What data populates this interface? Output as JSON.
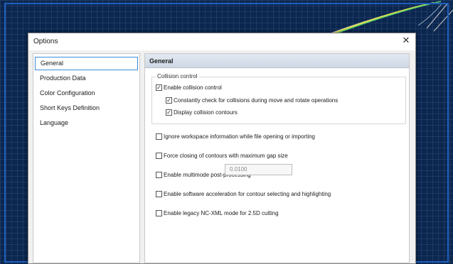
{
  "window": {
    "title": "Options",
    "close_glyph": "✕"
  },
  "nav": {
    "items": [
      {
        "label": "General",
        "selected": true
      },
      {
        "label": "Production Data",
        "selected": false
      },
      {
        "label": "Color Configuration",
        "selected": false
      },
      {
        "label": "Short Keys Definition",
        "selected": false
      },
      {
        "label": "Language",
        "selected": false
      }
    ]
  },
  "panel": {
    "title": "General",
    "collision_group": {
      "legend": "Collision control",
      "enable_collision": {
        "label": "Enable collision control",
        "checked": true
      },
      "constantly_check": {
        "label": "Constantly check for collisions during move and rotate operations",
        "checked": true
      },
      "display_contours": {
        "label": "Display collision contours",
        "checked": true
      }
    },
    "options": {
      "ignore_workspace": {
        "label": "Ignore workspace information while file opening or importing",
        "checked": false
      },
      "force_closing": {
        "label": "Force closing of contours with maximum gap size",
        "checked": false
      },
      "multimode": {
        "label": "Enable multimode post-processing",
        "checked": false
      },
      "software_accel": {
        "label": "Enable software acceleration for contour selecting and highlighting",
        "checked": false
      },
      "legacy_ncxml": {
        "label": "Enable legacy NC-XML mode for 2.5D cutting",
        "checked": false
      }
    },
    "gap_size_value": "0.0100"
  },
  "colors": {
    "background": "#0b2750",
    "frame": "#1f5fbf",
    "selection_border": "#3b8ddd",
    "curve_yellow": "#e8e24a",
    "curve_green": "#5fd16a"
  }
}
